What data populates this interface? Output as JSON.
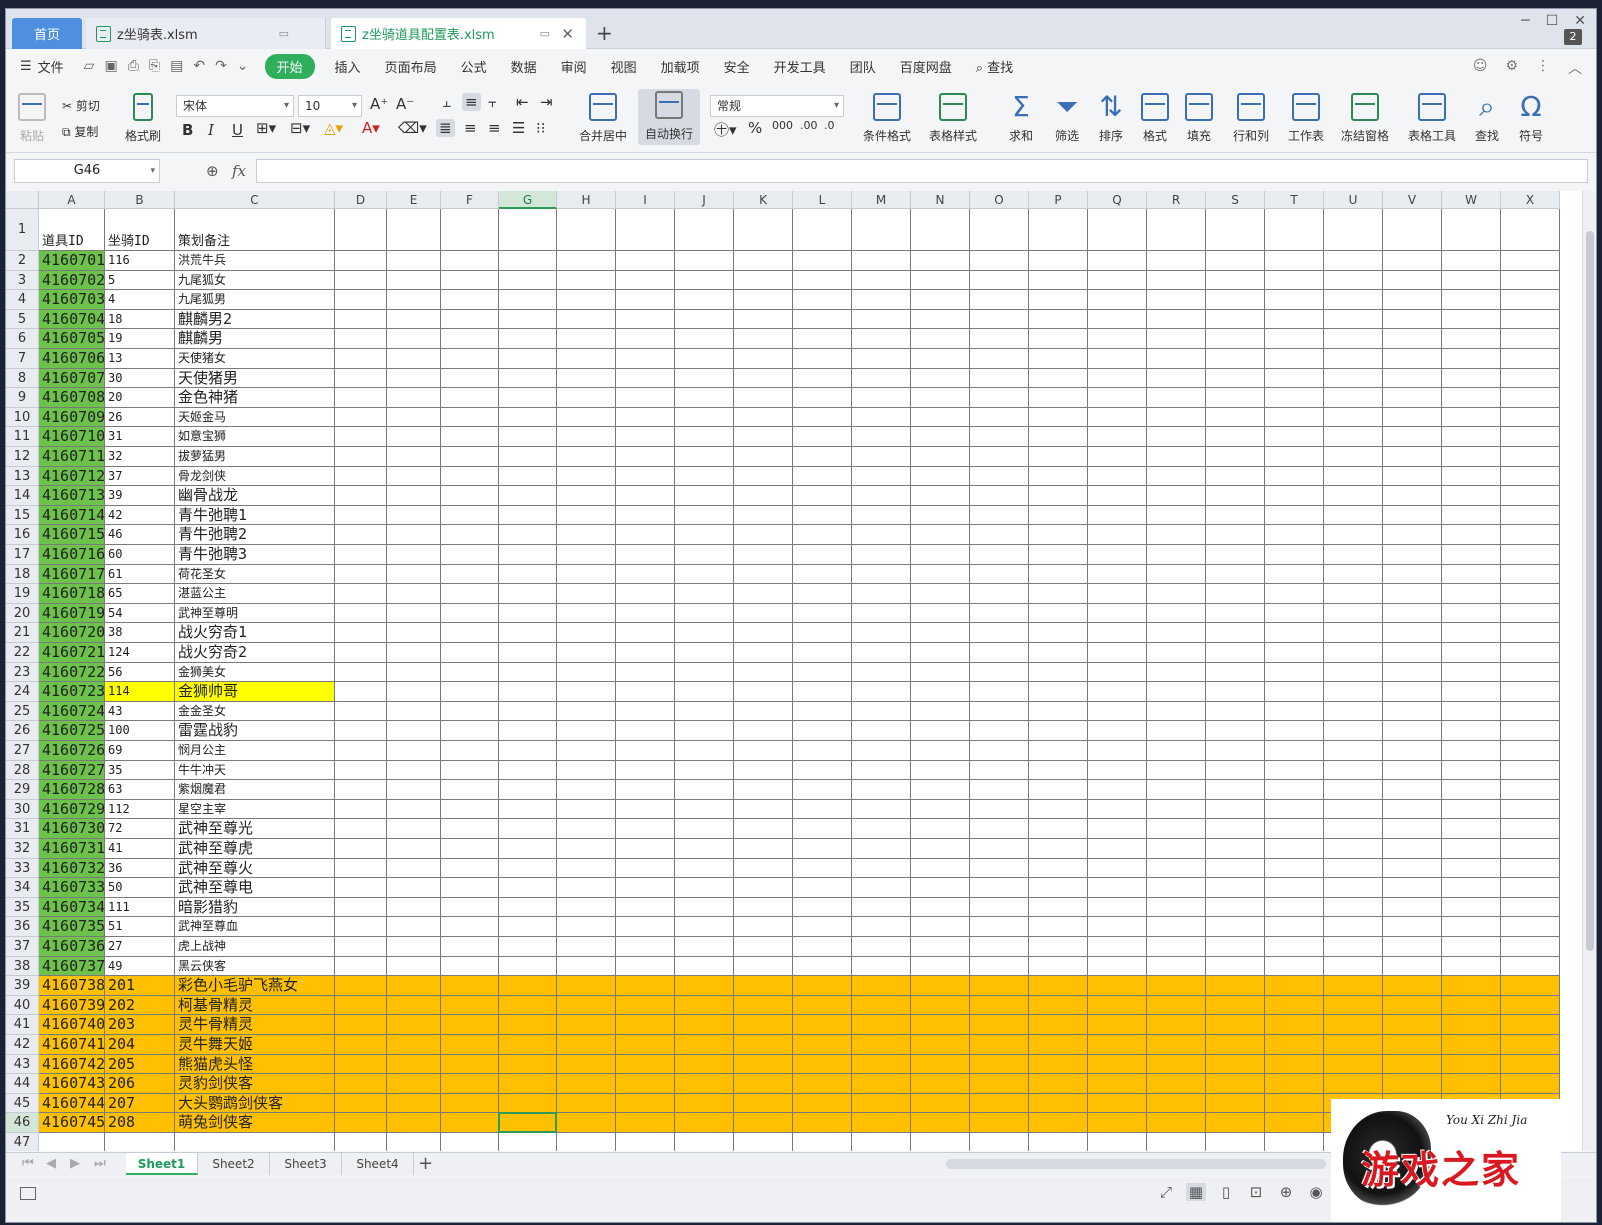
{
  "tabs": {
    "home": "首页",
    "file1": "z坐骑表.xlsm",
    "file2": "z坐骑道具配置表.xlsm",
    "window_count": "2"
  },
  "menu": {
    "file": "文件",
    "items": [
      "开始",
      "插入",
      "页面布局",
      "公式",
      "数据",
      "审阅",
      "视图",
      "加载项",
      "安全",
      "开发工具",
      "团队",
      "百度网盘"
    ],
    "search": "查找"
  },
  "ribbon": {
    "paste": "粘贴",
    "cut": "剪切",
    "copy": "复制",
    "format_painter": "格式刷",
    "font_name": "宋体",
    "font_size": "10",
    "merge_center": "合并居中",
    "wrap_text": "自动换行",
    "number_format": "常规",
    "cond_format": "条件格式",
    "table_style": "表格样式",
    "sum": "求和",
    "filter": "筛选",
    "sort": "排序",
    "format": "格式",
    "fill": "填充",
    "row_col": "行和列",
    "worksheet": "工作表",
    "freeze": "冻结窗格",
    "table_tools": "表格工具",
    "find": "查找",
    "symbol": "符号"
  },
  "formula_bar": {
    "name_box": "G46",
    "fx": "fx",
    "value": ""
  },
  "columns": [
    "A",
    "B",
    "C",
    "D",
    "E",
    "F",
    "G",
    "H",
    "I",
    "J",
    "K",
    "L",
    "M",
    "N",
    "O",
    "P",
    "Q",
    "R",
    "S",
    "T",
    "U",
    "V",
    "W",
    "X"
  ],
  "selected_cell": "G46",
  "header_row": {
    "a": "道具ID",
    "b": "坐骑ID",
    "c": "策划备注"
  },
  "rows": [
    {
      "r": 2,
      "a": "4160701",
      "b": "116",
      "c": "洪荒牛兵",
      "big": false
    },
    {
      "r": 3,
      "a": "4160702",
      "b": "5",
      "c": "九尾狐女",
      "big": false
    },
    {
      "r": 4,
      "a": "4160703",
      "b": "4",
      "c": "九尾狐男",
      "big": false
    },
    {
      "r": 5,
      "a": "4160704",
      "b": "18",
      "c": "麒麟男2",
      "big": true
    },
    {
      "r": 6,
      "a": "4160705",
      "b": "19",
      "c": "麒麟男",
      "big": true
    },
    {
      "r": 7,
      "a": "4160706",
      "b": "13",
      "c": "天使猪女",
      "big": false
    },
    {
      "r": 8,
      "a": "4160707",
      "b": "30",
      "c": "天使猪男",
      "big": true
    },
    {
      "r": 9,
      "a": "4160708",
      "b": "20",
      "c": "金色神猪",
      "big": true
    },
    {
      "r": 10,
      "a": "4160709",
      "b": "26",
      "c": "天姬金马",
      "big": false
    },
    {
      "r": 11,
      "a": "4160710",
      "b": "31",
      "c": "如意宝狮",
      "big": false
    },
    {
      "r": 12,
      "a": "4160711",
      "b": "32",
      "c": "拔萝猛男",
      "big": false
    },
    {
      "r": 13,
      "a": "4160712",
      "b": "37",
      "c": "骨龙剑侠",
      "big": false
    },
    {
      "r": 14,
      "a": "4160713",
      "b": "39",
      "c": "幽骨战龙",
      "big": true
    },
    {
      "r": 15,
      "a": "4160714",
      "b": "42",
      "c": "青牛弛聘1",
      "big": true
    },
    {
      "r": 16,
      "a": "4160715",
      "b": "46",
      "c": "青牛弛聘2",
      "big": true
    },
    {
      "r": 17,
      "a": "4160716",
      "b": "60",
      "c": "青牛弛聘3",
      "big": true
    },
    {
      "r": 18,
      "a": "4160717",
      "b": "61",
      "c": "荷花圣女",
      "big": false
    },
    {
      "r": 19,
      "a": "4160718",
      "b": "65",
      "c": "湛蓝公主",
      "big": false
    },
    {
      "r": 20,
      "a": "4160719",
      "b": "54",
      "c": "武神至尊明",
      "big": false
    },
    {
      "r": 21,
      "a": "4160720",
      "b": "38",
      "c": "战火穷奇1",
      "big": true
    },
    {
      "r": 22,
      "a": "4160721",
      "b": "124",
      "c": "战火穷奇2",
      "big": true
    },
    {
      "r": 23,
      "a": "4160722",
      "b": "56",
      "c": "金狮美女",
      "big": false
    },
    {
      "r": 24,
      "a": "4160723",
      "b": "114",
      "c": "金狮帅哥",
      "big": true,
      "hl": "yellow"
    },
    {
      "r": 25,
      "a": "4160724",
      "b": "43",
      "c": "金金圣女",
      "big": false
    },
    {
      "r": 26,
      "a": "4160725",
      "b": "100",
      "c": "雷霆战豹",
      "big": true
    },
    {
      "r": 27,
      "a": "4160726",
      "b": "69",
      "c": "悯月公主",
      "big": false
    },
    {
      "r": 28,
      "a": "4160727",
      "b": "35",
      "c": "牛牛冲天",
      "big": false
    },
    {
      "r": 29,
      "a": "4160728",
      "b": "63",
      "c": "紫烟魔君",
      "big": false
    },
    {
      "r": 30,
      "a": "4160729",
      "b": "112",
      "c": "星空主宰",
      "big": false
    },
    {
      "r": 31,
      "a": "4160730",
      "b": "72",
      "c": "武神至尊光",
      "big": true
    },
    {
      "r": 32,
      "a": "4160731",
      "b": "41",
      "c": "武神至尊虎",
      "big": true
    },
    {
      "r": 33,
      "a": "4160732",
      "b": "36",
      "c": "武神至尊火",
      "big": true
    },
    {
      "r": 34,
      "a": "4160733",
      "b": "50",
      "c": "武神至尊电",
      "big": true
    },
    {
      "r": 35,
      "a": "4160734",
      "b": "111",
      "c": "暗影猎豹",
      "big": true
    },
    {
      "r": 36,
      "a": "4160735",
      "b": "51",
      "c": "武神至尊血",
      "big": false
    },
    {
      "r": 37,
      "a": "4160736",
      "b": "27",
      "c": "虎上战神",
      "big": false
    },
    {
      "r": 38,
      "a": "4160737",
      "b": "49",
      "c": "黑云侠客",
      "big": false
    },
    {
      "r": 39,
      "a": "4160738",
      "b": "201",
      "c": "彩色小毛驴飞燕女",
      "big": true,
      "hl": "orange"
    },
    {
      "r": 40,
      "a": "4160739",
      "b": "202",
      "c": "柯基骨精灵",
      "big": true,
      "hl": "orange"
    },
    {
      "r": 41,
      "a": "4160740",
      "b": "203",
      "c": "灵牛骨精灵",
      "big": true,
      "hl": "orange"
    },
    {
      "r": 42,
      "a": "4160741",
      "b": "204",
      "c": "灵牛舞天姬",
      "big": true,
      "hl": "orange"
    },
    {
      "r": 43,
      "a": "4160742",
      "b": "205",
      "c": "熊猫虎头怪",
      "big": true,
      "hl": "orange"
    },
    {
      "r": 44,
      "a": "4160743",
      "b": "206",
      "c": "灵豹剑侠客",
      "big": true,
      "hl": "orange"
    },
    {
      "r": 45,
      "a": "4160744",
      "b": "207",
      "c": "大头鹦鹉剑侠客",
      "big": true,
      "hl": "orange"
    },
    {
      "r": 46,
      "a": "4160745",
      "b": "208",
      "c": "萌兔剑侠客",
      "big": true,
      "hl": "orange"
    }
  ],
  "extra_row": 47,
  "colors": {
    "id_green": "#6cc24a",
    "yellow": "#ffff00",
    "orange": "#ffc000"
  },
  "sheets": [
    "Sheet1",
    "Sheet2",
    "Sheet3",
    "Sheet4"
  ],
  "active_sheet": "Sheet1",
  "logo": {
    "text": "游戏之家",
    "en": "You Xi Zhi Jia"
  }
}
